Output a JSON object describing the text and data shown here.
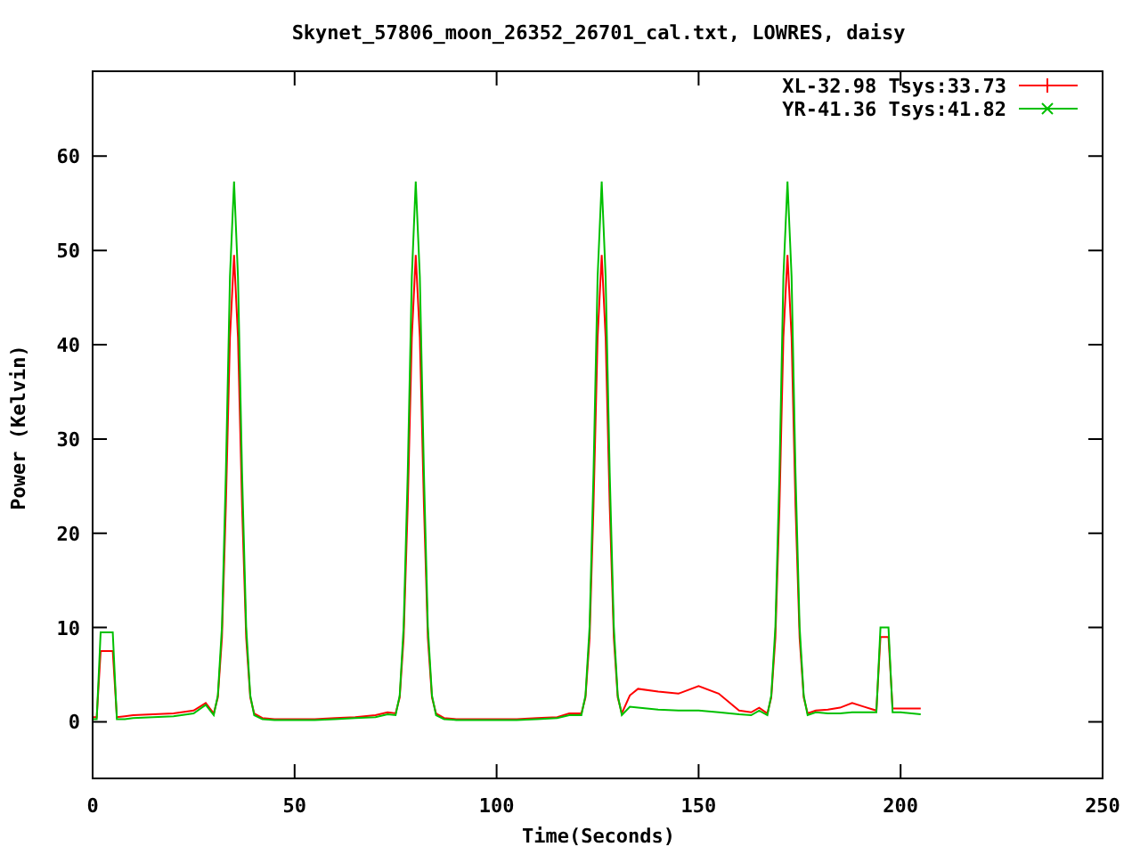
{
  "chart_data": {
    "type": "line",
    "title": "Skynet_57806_moon_26352_26701_cal.txt, LOWRES, daisy",
    "xlabel": "Time(Seconds)",
    "ylabel": "Power (Kelvin)",
    "xlim": [
      0,
      250
    ],
    "ylim": [
      -6,
      69
    ],
    "xticks": [
      0,
      50,
      100,
      150,
      200,
      250
    ],
    "yticks": [
      0,
      10,
      20,
      30,
      40,
      50,
      60
    ],
    "legend": "top right",
    "x": [
      0,
      1,
      2,
      3,
      4,
      5,
      6,
      8,
      10,
      15,
      20,
      25,
      28,
      30,
      31,
      32,
      33,
      34,
      35,
      36,
      37,
      38,
      39,
      40,
      42,
      45,
      50,
      55,
      60,
      65,
      70,
      73,
      75,
      76,
      77,
      78,
      79,
      80,
      81,
      82,
      83,
      84,
      85,
      87,
      90,
      95,
      100,
      105,
      110,
      115,
      118,
      121,
      122,
      123,
      124,
      125,
      126,
      127,
      128,
      129,
      130,
      131,
      133,
      135,
      140,
      145,
      150,
      155,
      160,
      163,
      165,
      167,
      168,
      169,
      170,
      171,
      172,
      173,
      174,
      175,
      176,
      177,
      179,
      182,
      185,
      188,
      191,
      194,
      195,
      196,
      197,
      198,
      199,
      200,
      205
    ],
    "series": [
      {
        "name": "XL-32.98 Tsys:33.73",
        "color": "#ff0000",
        "values": [
          0.5,
          0.5,
          7.5,
          7.5,
          7.5,
          7.5,
          0.5,
          0.6,
          0.7,
          0.8,
          0.9,
          1.2,
          2.0,
          0.9,
          2.6,
          8.9,
          22.9,
          40.8,
          49.5,
          40.8,
          22.9,
          8.9,
          2.6,
          0.9,
          0.4,
          0.3,
          0.3,
          0.3,
          0.4,
          0.5,
          0.7,
          1.0,
          0.9,
          2.6,
          8.9,
          22.9,
          40.8,
          49.5,
          40.8,
          22.9,
          8.9,
          2.6,
          0.9,
          0.4,
          0.3,
          0.3,
          0.3,
          0.3,
          0.4,
          0.5,
          0.9,
          0.9,
          2.6,
          8.9,
          22.9,
          40.8,
          49.5,
          40.8,
          22.9,
          8.9,
          2.6,
          0.9,
          2.8,
          3.5,
          3.2,
          3.0,
          3.8,
          3.0,
          1.2,
          1.0,
          1.5,
          0.9,
          2.6,
          8.9,
          22.9,
          40.8,
          49.5,
          40.8,
          22.9,
          8.9,
          2.6,
          0.9,
          1.2,
          1.3,
          1.5,
          2.0,
          1.6,
          1.2,
          9.0,
          9.0,
          9.0,
          1.4,
          1.4,
          1.4,
          1.4
        ]
      },
      {
        "name": "YR-41.36 Tsys:41.82",
        "color": "#00c000",
        "values": [
          0.3,
          0.3,
          9.5,
          9.5,
          9.5,
          9.5,
          0.3,
          0.3,
          0.4,
          0.5,
          0.6,
          0.9,
          1.8,
          0.7,
          2.8,
          10.1,
          26.4,
          47.2,
          57.3,
          47.2,
          26.4,
          10.1,
          2.8,
          0.7,
          0.3,
          0.2,
          0.2,
          0.2,
          0.3,
          0.4,
          0.5,
          0.8,
          0.7,
          2.8,
          10.1,
          26.4,
          47.2,
          57.3,
          47.2,
          26.4,
          10.1,
          2.8,
          0.7,
          0.3,
          0.2,
          0.2,
          0.2,
          0.2,
          0.3,
          0.4,
          0.7,
          0.7,
          2.8,
          10.1,
          26.4,
          47.2,
          57.3,
          47.2,
          26.4,
          10.1,
          2.8,
          0.7,
          1.6,
          1.5,
          1.3,
          1.2,
          1.2,
          1.0,
          0.8,
          0.7,
          1.2,
          0.7,
          2.8,
          10.1,
          26.4,
          47.2,
          57.3,
          47.2,
          26.4,
          10.1,
          2.8,
          0.7,
          1.0,
          0.9,
          0.9,
          1.0,
          1.0,
          1.0,
          10.0,
          10.0,
          10.0,
          1.0,
          1.0,
          1.0,
          0.8
        ]
      }
    ]
  }
}
